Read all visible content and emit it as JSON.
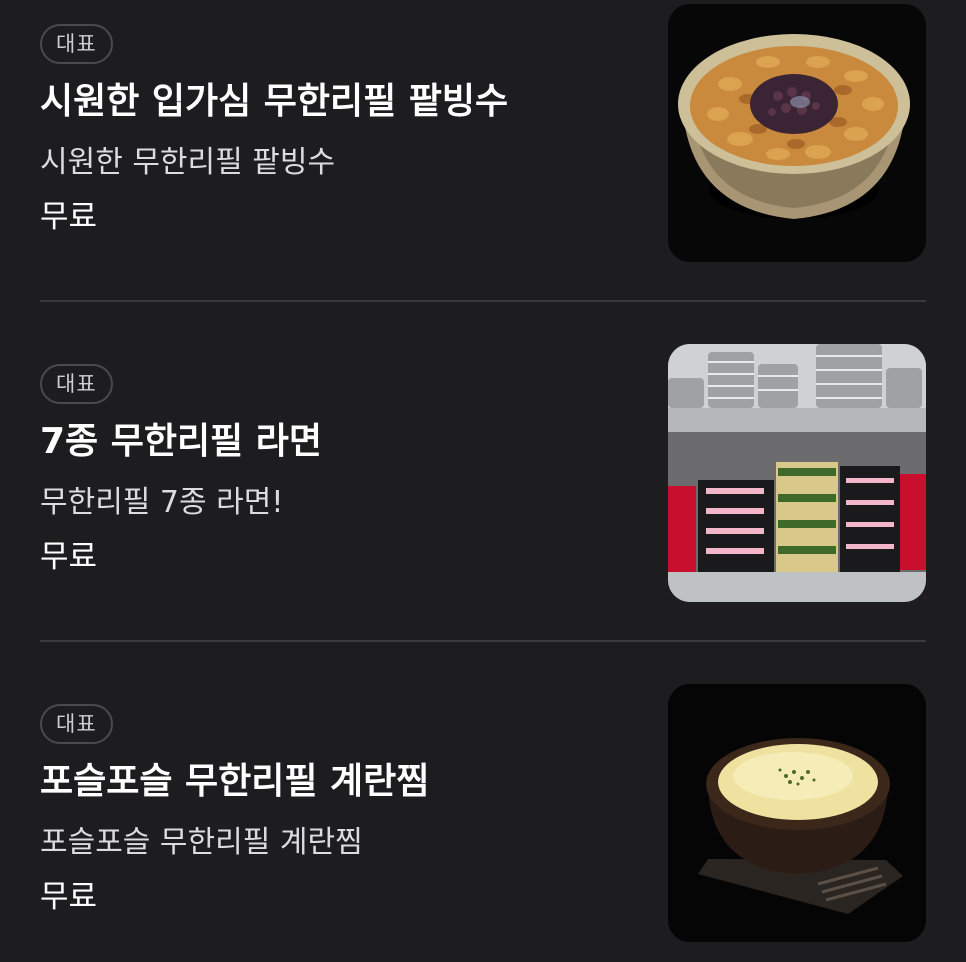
{
  "menu": {
    "items": [
      {
        "badge": "대표",
        "name": "시원한 입가심 무한리필 팥빙수",
        "description": "시원한 무한리필 팥빙수",
        "price": "무료",
        "image_icon": "patbingsu-photo"
      },
      {
        "badge": "대표",
        "name": "7종 무한리필 라면",
        "description": "무한리필 7종 라면!",
        "price": "무료",
        "image_icon": "ramen-shelf-photo"
      },
      {
        "badge": "대표",
        "name": "포슬포슬 무한리필 계란찜",
        "description": "포슬포슬 무한리필 계란찜",
        "price": "무료",
        "image_icon": "steamed-egg-photo"
      }
    ]
  },
  "colors": {
    "background": "#1d1d1f",
    "divider": "#3a3a3c",
    "badge_border": "#4a4a4c",
    "text_primary": "#ffffff",
    "text_secondary": "#dcdcde"
  }
}
